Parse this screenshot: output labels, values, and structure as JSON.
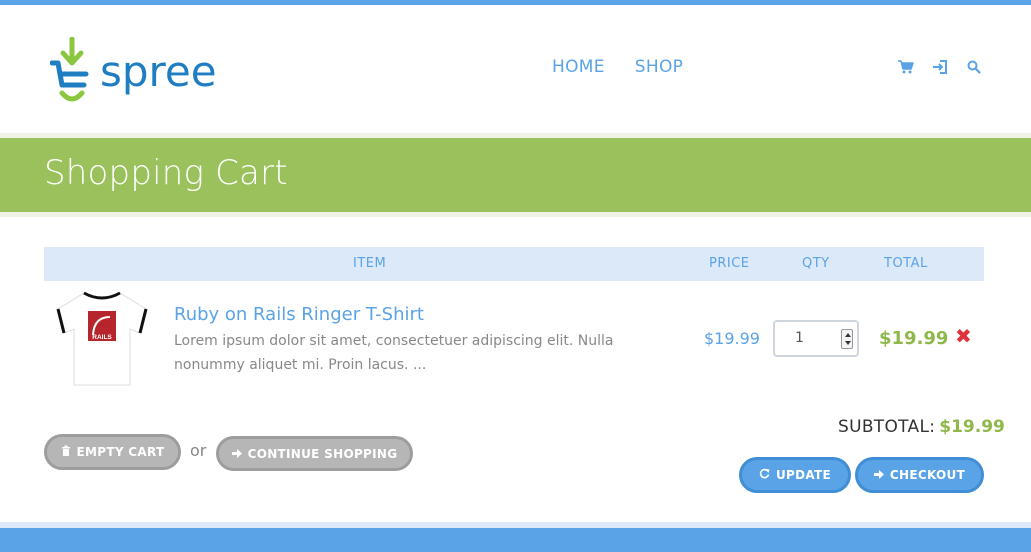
{
  "brand": {
    "name": "spree",
    "logo_colors": {
      "arrow": "#8cc63f",
      "text": "#1f7dc2"
    }
  },
  "nav": {
    "home": "HOME",
    "shop": "SHOP"
  },
  "header_icons": [
    "cart-icon",
    "login-icon",
    "search-icon"
  ],
  "page": {
    "title": "Shopping Cart"
  },
  "table": {
    "headers": {
      "item": "ITEM",
      "price": "PRICE",
      "qty": "QTY",
      "total": "TOTAL"
    },
    "rows": [
      {
        "name": "Ruby on Rails Ringer T-Shirt",
        "description": "Lorem ipsum dolor sit amet, consectetuer adipiscing elit. Nulla nonummy aliquet mi. Proin lacus. ...",
        "price": "$19.99",
        "qty": "1",
        "total": "$19.99",
        "thumb_text": "RAILS"
      }
    ]
  },
  "actions": {
    "empty_cart": "EMPTY CART",
    "or": "or",
    "continue_shopping": "CONTINUE SHOPPING",
    "update": "UPDATE",
    "checkout": "CHECKOUT"
  },
  "summary": {
    "subtotal_label": "SUBTOTAL:",
    "subtotal_value": "$19.99"
  },
  "colors": {
    "accent": "#5aa3e6",
    "green": "#9bc15d",
    "price_green": "#8fb84a",
    "remove_red": "#e0323b"
  }
}
